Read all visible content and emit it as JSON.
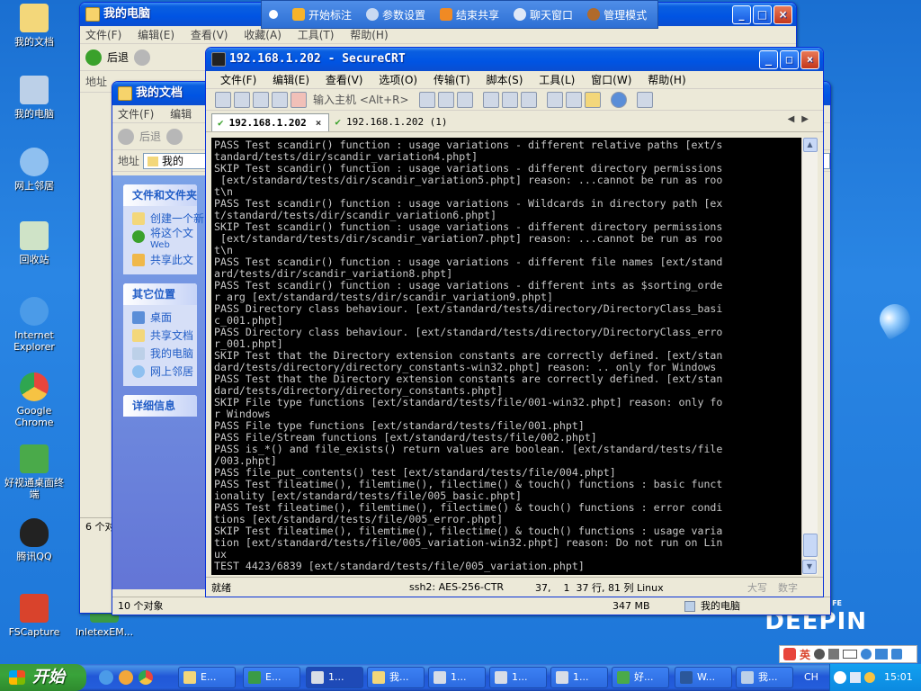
{
  "desktop": {
    "icons": [
      {
        "label": "我的文档",
        "color": "#f3d77a"
      },
      {
        "label": "我的电脑",
        "color": "#bcd0e8"
      },
      {
        "label": "网上邻居",
        "color": "#8fc0f0"
      },
      {
        "label": "回收站",
        "color": "#cfe3c7"
      },
      {
        "label": "Internet Explorer",
        "color": "#4b9be8"
      },
      {
        "label": "Google Chrome",
        "color": "#e8453c"
      },
      {
        "label": "好视通桌面终端",
        "color": "#4aaa4a"
      },
      {
        "label": "腾讯QQ",
        "color": "#222222"
      },
      {
        "label": "FSCapture",
        "color": "#d9432c"
      },
      {
        "label": "InletexEM...",
        "color": "#3a9b45"
      }
    ],
    "brand": "DEEPIN",
    "brand_sup": "FE"
  },
  "floatbar": {
    "items": [
      {
        "label": "",
        "color": "#ffffff"
      },
      {
        "label": "开始标注",
        "color": "#f7b32b"
      },
      {
        "label": "参数设置",
        "color": "#c9d9f2"
      },
      {
        "label": "结束共享",
        "color": "#f08a24"
      },
      {
        "label": "聊天窗口",
        "color": "#dfe8f7"
      },
      {
        "label": "管理模式",
        "color": "#b06a2b"
      }
    ]
  },
  "mycomputer": {
    "title": "我的电脑",
    "menu": [
      "文件(F)",
      "编辑(E)",
      "查看(V)",
      "收藏(A)",
      "工具(T)",
      "帮助(H)"
    ],
    "back": "后退",
    "address_label": "地址",
    "status_count": "6 个对",
    "status_objects": "10 个对象",
    "status_size": "347 MB",
    "status_location": "我的电脑"
  },
  "mydocs": {
    "title": "我的文档",
    "menu": [
      "文件(F)",
      "编辑"
    ],
    "back": "后退",
    "address_label": "地址",
    "address_value": "我的",
    "pane1_title": "文件和文件夹",
    "pane1_items": [
      "创建一个新",
      "将这个文",
      "Web",
      "共享此文"
    ],
    "pane2_title": "其它位置",
    "pane2_items": [
      "桌面",
      "共享文档",
      "我的电脑",
      "网上邻居"
    ],
    "pane3_title": "详细信息"
  },
  "crt": {
    "title": "192.168.1.202 - SecureCRT",
    "menu": [
      "文件(F)",
      "编辑(E)",
      "查看(V)",
      "选项(O)",
      "传输(T)",
      "脚本(S)",
      "工具(L)",
      "窗口(W)",
      "帮助(H)"
    ],
    "host_input_placeholder": "输入主机 <Alt+R>",
    "tabs": [
      {
        "label": "192.168.1.202",
        "active": true
      },
      {
        "label": "192.168.1.202  (1)",
        "active": false
      }
    ],
    "terminal_lines": [
      "PASS Test scandir() function : usage variations - different relative paths [ext/s",
      "tandard/tests/dir/scandir_variation4.phpt]",
      "SKIP Test scandir() function : usage variations - different directory permissions",
      " [ext/standard/tests/dir/scandir_variation5.phpt] reason: ...cannot be run as roo",
      "t\\n",
      "PASS Test scandir() function : usage variations - Wildcards in directory path [ex",
      "t/standard/tests/dir/scandir_variation6.phpt]",
      "SKIP Test scandir() function : usage variations - different directory permissions",
      " [ext/standard/tests/dir/scandir_variation7.phpt] reason: ...cannot be run as roo",
      "t\\n",
      "PASS Test scandir() function : usage variations - different file names [ext/stand",
      "ard/tests/dir/scandir_variation8.phpt]",
      "PASS Test scandir() function : usage variations - different ints as $sorting_orde",
      "r arg [ext/standard/tests/dir/scandir_variation9.phpt]",
      "PASS Directory class behaviour. [ext/standard/tests/directory/DirectoryClass_basi",
      "c_001.phpt]",
      "PASS Directory class behaviour. [ext/standard/tests/directory/DirectoryClass_erro",
      "r_001.phpt]",
      "SKIP Test that the Directory extension constants are correctly defined. [ext/stan",
      "dard/tests/directory/directory_constants-win32.phpt] reason: .. only for Windows",
      "PASS Test that the Directory extension constants are correctly defined. [ext/stan",
      "dard/tests/directory/directory_constants.phpt]",
      "SKIP File type functions [ext/standard/tests/file/001-win32.phpt] reason: only fo",
      "r Windows",
      "PASS File type functions [ext/standard/tests/file/001.phpt]",
      "PASS File/Stream functions [ext/standard/tests/file/002.phpt]",
      "PASS is_*() and file_exists() return values are boolean. [ext/standard/tests/file",
      "/003.phpt]",
      "PASS file_put_contents() test [ext/standard/tests/file/004.phpt]",
      "PASS Test fileatime(), filemtime(), filectime() & touch() functions : basic funct",
      "ionality [ext/standard/tests/file/005_basic.phpt]",
      "PASS Test fileatime(), filemtime(), filectime() & touch() functions : error condi",
      "tions [ext/standard/tests/file/005_error.phpt]",
      "SKIP Test fileatime(), filemtime(), filectime() & touch() functions : usage varia",
      "tion [ext/standard/tests/file/005_variation-win32.phpt] reason: Do not run on Lin",
      "ux",
      "TEST 4423/6839 [ext/standard/tests/file/005_variation.phpt]"
    ],
    "status": {
      "ready": "就绪",
      "protocol": "ssh2: AES-256-CTR",
      "cursor": "37,    1  37 行, 81 列 Linux",
      "caps": "大写",
      "num": "数字"
    }
  },
  "taskbar": {
    "start_label": "开始",
    "quicklaunch": [
      {
        "name": "ie",
        "color": "#4b9be8"
      },
      {
        "name": "browser",
        "color": "#f2a73a"
      },
      {
        "name": "chrome",
        "color": "#e8453c"
      }
    ],
    "tasks": [
      {
        "label": "E...",
        "color": "#f3d77a",
        "active": false
      },
      {
        "label": "E...",
        "color": "#3a9b45",
        "active": false
      },
      {
        "label": "1...",
        "color": "#d8dde6",
        "active": true
      },
      {
        "label": "我...",
        "color": "#f3d77a",
        "active": false
      },
      {
        "label": "1...",
        "color": "#d8dde6",
        "active": false
      },
      {
        "label": "1...",
        "color": "#d8dde6",
        "active": false
      },
      {
        "label": "1...",
        "color": "#d8dde6",
        "active": false
      },
      {
        "label": "好...",
        "color": "#4aaa4a",
        "active": false
      },
      {
        "label": "W...",
        "color": "#2b579a",
        "active": false
      },
      {
        "label": "我...",
        "color": "#bcd0e8",
        "active": false
      }
    ],
    "lang": "CH",
    "clock": "15:01",
    "ime": {
      "mode": "英"
    }
  }
}
